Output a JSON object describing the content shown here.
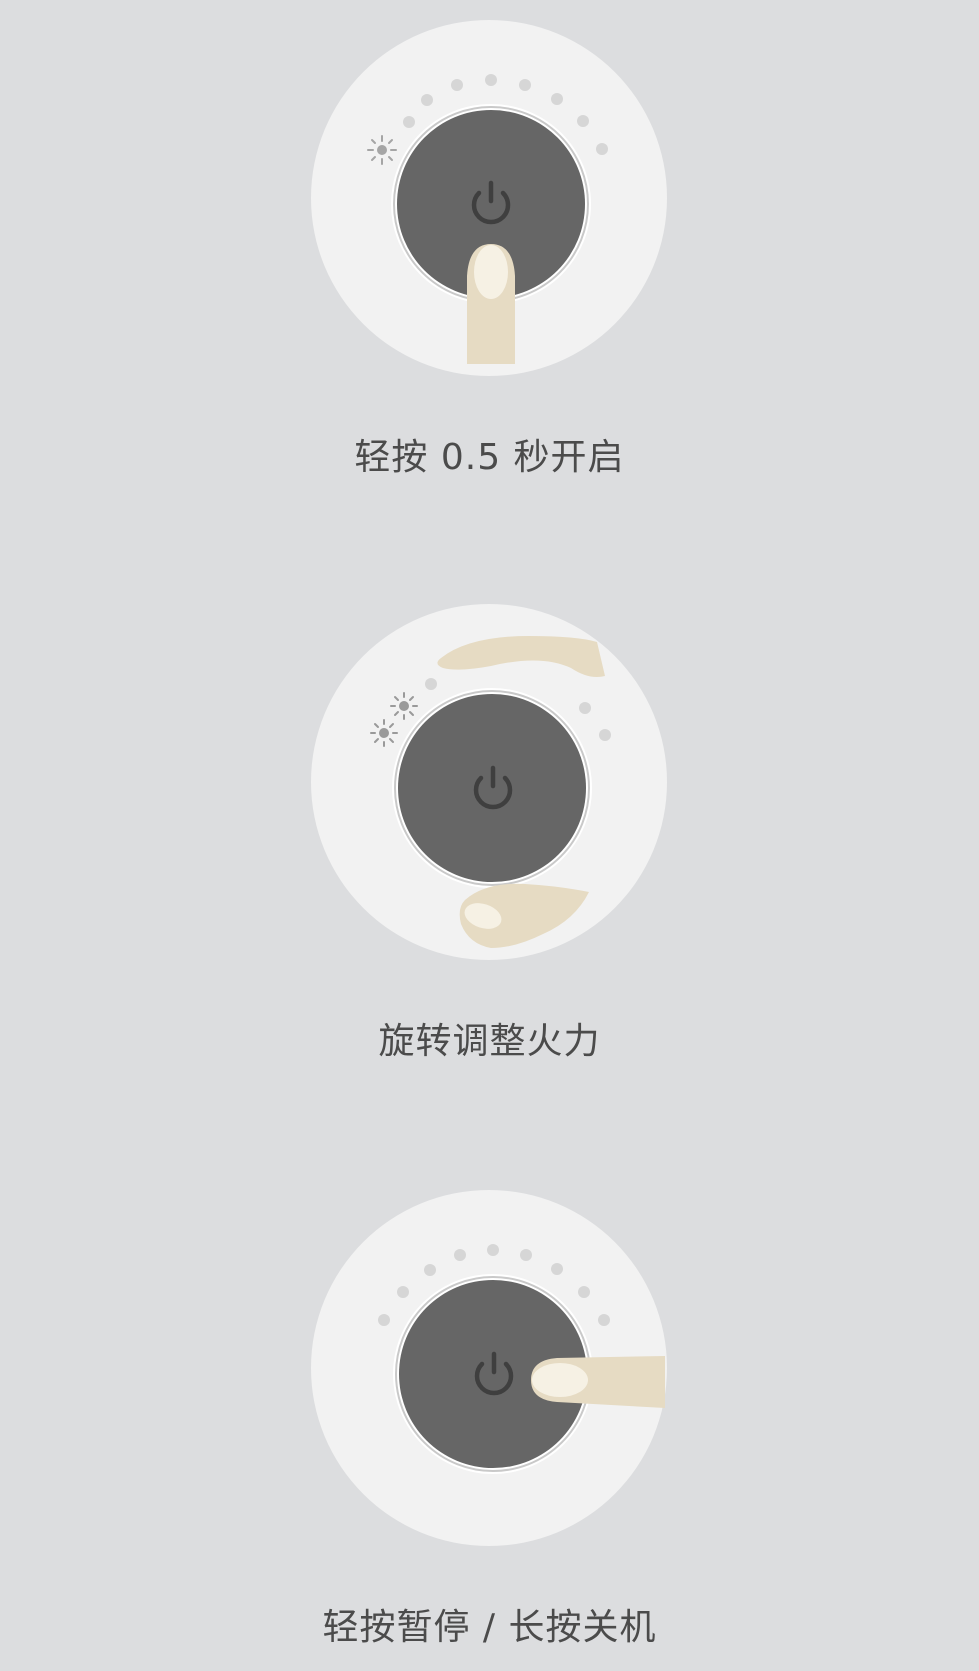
{
  "steps": [
    {
      "caption": "轻按 0.5 秒开启",
      "gesture": "tap",
      "icons": [
        "power-icon",
        "sun-icon",
        "finger-icon"
      ]
    },
    {
      "caption": "旋转调整火力",
      "gesture": "rotate",
      "icons": [
        "power-icon",
        "sun-icon",
        "sun-icon",
        "finger-icon",
        "thumb-icon"
      ]
    },
    {
      "caption": "轻按暂停 / 长按关机",
      "gesture": "tap-or-hold",
      "icons": [
        "power-icon",
        "finger-icon"
      ]
    }
  ],
  "colors": {
    "background": "#dcdddf",
    "dial_plate": "#f2f2f2",
    "knob": "#666666",
    "knob_ring": "#c9c9c9",
    "skin": "#e6dbc3",
    "nail": "#f6f1e4",
    "indicator_dot": "#d7d7d7",
    "indicator_lit": "#9a9a9a",
    "caption_text": "#4b4b4b"
  }
}
